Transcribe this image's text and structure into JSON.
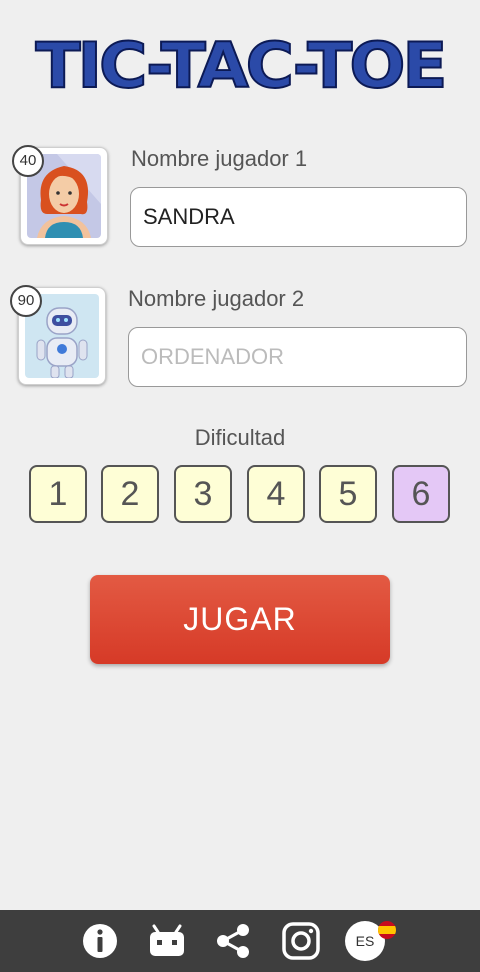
{
  "app": {
    "title": "TIC-TAC-TOE"
  },
  "players": [
    {
      "label": "Nombre jugador 1",
      "value": "SANDRA",
      "placeholder": "",
      "badge": "40",
      "avatar_icon": "woman-avatar-icon"
    },
    {
      "label": "Nombre jugador 2",
      "value": "",
      "placeholder": "ORDENADOR",
      "badge": "90",
      "avatar_icon": "robot-avatar-icon"
    }
  ],
  "difficulty": {
    "label": "Dificultad",
    "levels": [
      "1",
      "2",
      "3",
      "4",
      "5",
      "6"
    ],
    "selected": "6"
  },
  "play_button": {
    "label": "JUGAR"
  },
  "bottom_bar": {
    "icons": [
      "info-icon",
      "android-icon",
      "share-icon",
      "instagram-icon",
      "language-icon"
    ],
    "language": "ES"
  },
  "colors": {
    "title": "#2b4aa8",
    "play_button": "#d94a32",
    "difficulty_bg": "#fefed6",
    "difficulty_selected_bg": "#e4c8f6",
    "bottom_bar": "#3e3e3e"
  }
}
